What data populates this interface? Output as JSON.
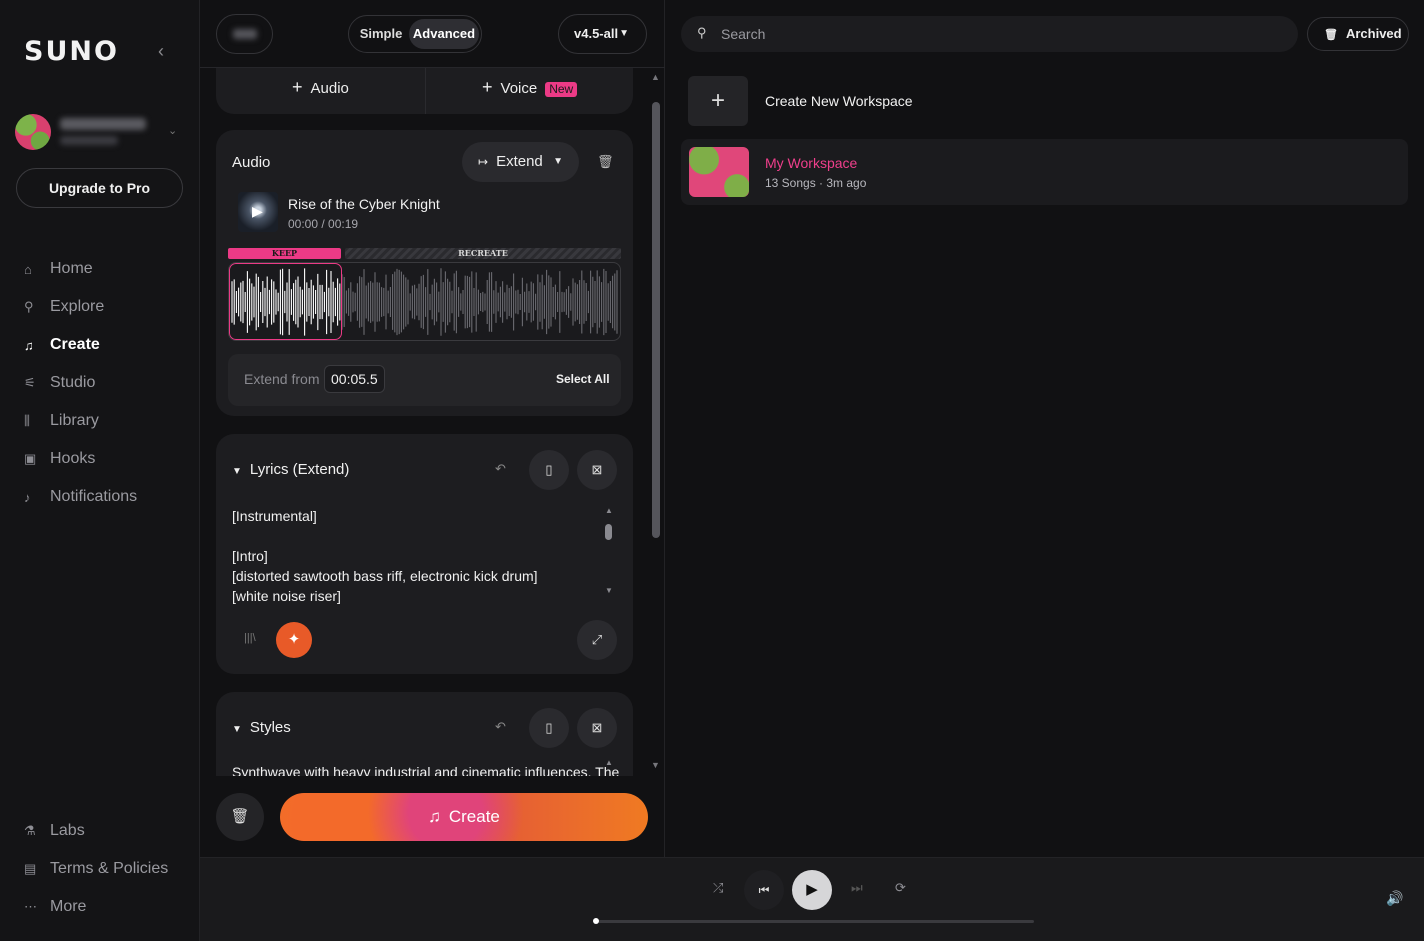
{
  "sidebar": {
    "logo": "SUNO",
    "upgrade_label": "Upgrade to Pro",
    "nav": [
      {
        "label": "Home",
        "icon": "home-icon",
        "glyph": "⌂"
      },
      {
        "label": "Explore",
        "icon": "search-icon",
        "glyph": "⚲"
      },
      {
        "label": "Create",
        "icon": "music-note-icon",
        "glyph": "♫",
        "active": true
      },
      {
        "label": "Studio",
        "icon": "sliders-icon",
        "glyph": "⚟"
      },
      {
        "label": "Library",
        "icon": "library-icon",
        "glyph": "⫼"
      },
      {
        "label": "Hooks",
        "icon": "hooks-icon",
        "glyph": "▣"
      },
      {
        "label": "Notifications",
        "icon": "bell-icon",
        "glyph": "♪"
      }
    ],
    "bottom": [
      {
        "label": "Labs",
        "icon": "flask-icon",
        "glyph": "⚗"
      },
      {
        "label": "Terms & Policies",
        "icon": "document-icon",
        "glyph": "▤"
      },
      {
        "label": "More",
        "icon": "more-icon",
        "glyph": "⋯"
      }
    ]
  },
  "create": {
    "mode": {
      "simple": "Simple",
      "advanced": "Advanced",
      "selected": "Advanced"
    },
    "version": "v4.5-all",
    "add_audio": "Audio",
    "add_voice": "Voice",
    "new_badge": "New",
    "audio_card": {
      "title": "Audio",
      "extend_label": "Extend",
      "song_title": "Rise of the Cyber Knight",
      "song_time": "00:00 / 00:19",
      "keep_label": "KEEP",
      "recreate_label": "RECREATE",
      "extend_from_label": "Extend from",
      "extend_from_value": "00:05.5",
      "select_all": "Select All"
    },
    "lyrics_card": {
      "title": "Lyrics (Extend)",
      "text": "[Instrumental]\n\n[Intro]\n[distorted sawtooth bass riff, electronic kick drum]\n[white noise riser]"
    },
    "styles_card": {
      "title": "Styles",
      "text": "Synthwave with heavy industrial and cinematic influences. The"
    },
    "create_label": "Create"
  },
  "workspaces": {
    "search_placeholder": "Search",
    "archived_label": "Archived",
    "create_new_label": "Create New Workspace",
    "items": [
      {
        "name": "My Workspace",
        "meta": "13 Songs · 3m ago"
      }
    ]
  },
  "player": {
    "progress": 0.0
  },
  "colors": {
    "accent_pink": "#ec3a86",
    "accent_orange": "#e85a28"
  }
}
